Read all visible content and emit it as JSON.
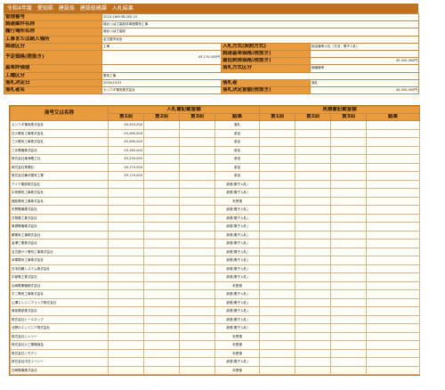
{
  "title": "令和4年度　愛知県　建設局　建設総務課　入札結果",
  "info": {
    "kanri_label": "管理番号",
    "kanri_value": "2022-160536-000-15",
    "anken_label": "調達案件名称",
    "anken_value": "城北つばさ高校体育館電気工事",
    "basho_label": "履行場所名称",
    "basho_value": "城北つばさ高校",
    "nonyu_label": "工事または納入場所",
    "nonyu_value": "名古屋市北区",
    "kubun_label": "調達区分",
    "kubun_value": "工事",
    "hoshiki_label": "入札方式(契約方式)",
    "hoshiki_value": "指名競争入札（方法：電子入札）",
    "yotei_label": "予定価格(税抜き)",
    "yotei_value": "49,170,000円",
    "kijun_label": "調達基準価格(税抜き)",
    "kijun_value": "",
    "saitei_label": "最低制限価格(税抜き)",
    "saitei_value": "45,050,000円",
    "hyoka_label": "基準評価値",
    "hyoka_value": "",
    "keishiki_label": "落札方式区分",
    "keishiki_value": "価格競争",
    "gyoshu_label": "工種区分",
    "gyoshu_value": "電気工事",
    "kettei_label": "落札決定日",
    "kettei_value": "2004/10/31",
    "rakusatsu_shosai_label": "落札者",
    "rakusatsu_shosai_value": "落札",
    "sha_label": "落札者名",
    "sha_value": "カシワギ電気株式会社",
    "kingaku_label": "落札決定金額(税抜き)",
    "kingaku_value": "45,050,000円"
  },
  "bid_table": {
    "h_company": "商号又は名称",
    "h_group1": "入札書記載金額",
    "h_group2": "見積書記載金額",
    "h_r1": "第1回",
    "h_r2": "第2回",
    "h_r3": "第3回",
    "h_result": "結果",
    "rows": [
      {
        "company": "カシワギ電気株式会社",
        "r1": "45,050,000",
        "result": "落札"
      },
      {
        "company": "白川電気工事株式会社",
        "r1": "45,060,000",
        "result": "参加"
      },
      {
        "company": "三川電気工事株式会社",
        "r1": "45,060,000",
        "result": "参加"
      },
      {
        "company": "三光電機株式会社",
        "r1": "45,180,000",
        "result": "参加"
      },
      {
        "company": "株式会社東海電工社",
        "r1": "45,230,000",
        "result": "参加"
      },
      {
        "company": "株式会社青電社",
        "r1": "49,170,000",
        "result": "参加"
      },
      {
        "company": "株式会社備北電気工業",
        "r1": "49,170,000",
        "result": "参加"
      },
      {
        "company": "アイテ電設株式会社",
        "r1": "",
        "result": "辞退(電子入札)"
      },
      {
        "company": "中央電気工事株式会社",
        "r1": "",
        "result": "辞退(電子入札)"
      },
      {
        "company": "福松電気工事株式会社",
        "r1": "",
        "result": "未受領"
      },
      {
        "company": "矢野電機株式会社",
        "r1": "",
        "result": "辞退(電子入札)"
      },
      {
        "company": "日翔電工株式会社",
        "r1": "",
        "result": "辞退(電子入札)"
      },
      {
        "company": "東健電機株式会社",
        "r1": "",
        "result": "辞退(電子入札)"
      },
      {
        "company": "鯱電気工事株式会社",
        "r1": "",
        "result": "辞退(電子入札)"
      },
      {
        "company": "金澤工業株式会社",
        "r1": "",
        "result": "辞退(電子入札)"
      },
      {
        "company": "名古屋サイ電気工事株式会社",
        "r1": "",
        "result": "辞退(電子入札)"
      },
      {
        "company": "尚電電気工事株式会社",
        "r1": "",
        "result": "辞退(電子入札)"
      },
      {
        "company": "日本信頼システム株式会社",
        "r1": "",
        "result": "辞退(電子入札)"
      },
      {
        "company": "中部電工株式会社",
        "r1": "",
        "result": "辞退(電子入札)"
      },
      {
        "company": "瓜崎電業機株式会社",
        "r1": "",
        "result": "未受領"
      },
      {
        "company": "平二電気工事株式会社",
        "r1": "",
        "result": "辞退(電子入札)"
      },
      {
        "company": "山澤エンジニアリング株式会社",
        "r1": "",
        "result": "辞退(電子入札)"
      },
      {
        "company": "東各電設株式会社",
        "r1": "",
        "result": "辞退(電子入札)"
      },
      {
        "company": "株式会社トーエネック",
        "r1": "",
        "result": "辞退(電子入札)"
      },
      {
        "company": "北野のエンジニア株式会社",
        "r1": "",
        "result": "辞退(電子入札)"
      },
      {
        "company": "株式会社シンリー",
        "r1": "",
        "result": "未受領"
      },
      {
        "company": "株式会社六三電機商会",
        "r1": "",
        "result": "未受領"
      },
      {
        "company": "株式会社シモデン",
        "r1": "",
        "result": "未受領"
      },
      {
        "company": "株式会社中日イーシー",
        "r1": "",
        "result": "辞退(電子入札)"
      },
      {
        "company": "石崎電機株式会社",
        "r1": "",
        "result": "未受領"
      }
    ]
  }
}
